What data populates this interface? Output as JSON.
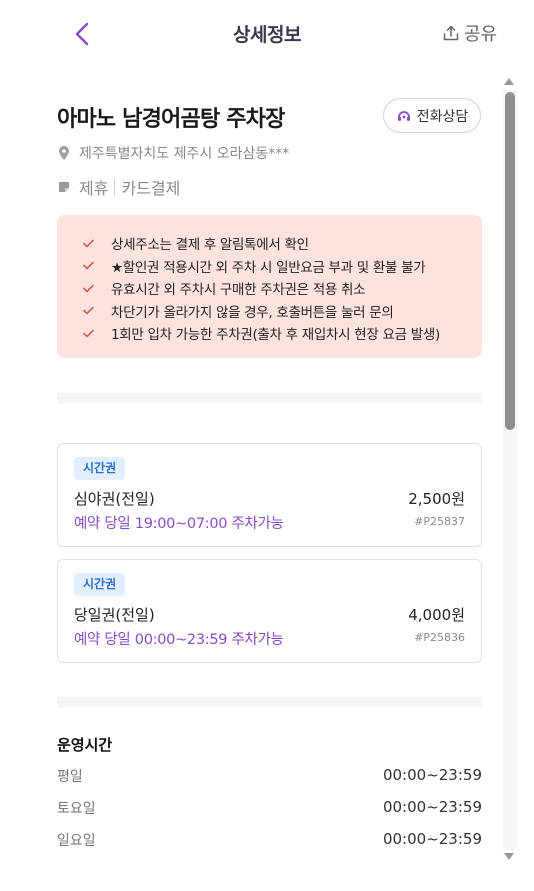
{
  "header": {
    "title": "상세정보",
    "share_label": "공유",
    "accent_color": "#8a4bc8"
  },
  "lot": {
    "name": "아마노 남경어곰탕 주차장",
    "call_label": "전화상담",
    "address": "제주특별자치도 제주시 오라삼동***",
    "tags": [
      "제휴",
      "카드결제"
    ]
  },
  "notices": [
    "상세주소는 결제 후 알림톡에서 확인",
    "★할인권 적용시간 외 주차 시 일반요금 부과 및 환불 불가",
    "유효시간 외 주차시 구매한 주차권은 적용 취소",
    "차단기가 올라가지 않을 경우, 호출버튼을 눌러 문의",
    "1회만 입차 가능한 주차권(출차 후 재입차시 현장 요금 발생)"
  ],
  "tickets": [
    {
      "badge": "시간권",
      "name": "심야권(전일)",
      "price": "2,500원",
      "time": "예약 당일 19:00~07:00 주차가능",
      "code": "#P25837"
    },
    {
      "badge": "시간권",
      "name": "당일권(전일)",
      "price": "4,000원",
      "time": "예약 당일 00:00~23:59 주차가능",
      "code": "#P25836"
    }
  ],
  "hours": {
    "title": "운영시간",
    "rows": [
      {
        "label": "평일",
        "value": "00:00~23:59"
      },
      {
        "label": "토요일",
        "value": "00:00~23:59"
      },
      {
        "label": "일요일",
        "value": "00:00~23:59"
      }
    ]
  }
}
